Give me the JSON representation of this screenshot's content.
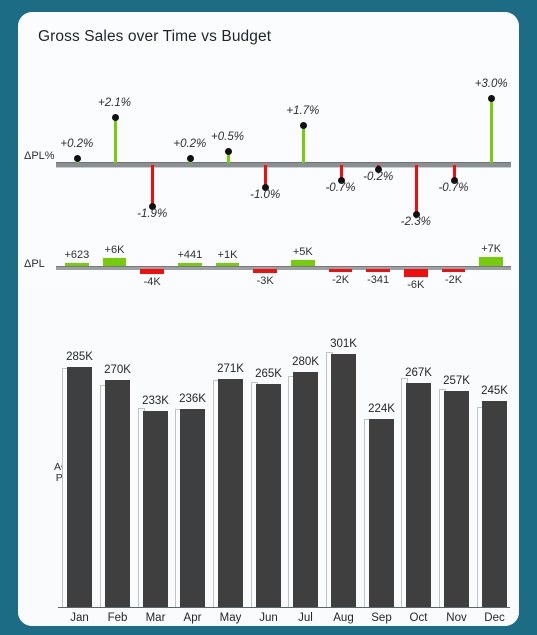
{
  "card": {
    "title": "Gross Sales over Time vs Budget",
    "background": "#1d6c85",
    "surface": "#fbfcfd"
  },
  "axes": {
    "pct_row_label": "ΔPL%",
    "abs_row_label": "ΔPL",
    "series_legend_line1": "AC",
    "series_legend_line2": "PL"
  },
  "colors": {
    "positive": "#76cc0a",
    "negative": "#f40d0d",
    "actual_bar": "#403f3f",
    "plan_bar_outline": "#bfc3c6",
    "marker": "#111111",
    "axis": "#8a8f92"
  },
  "chart_data": {
    "type": "bar",
    "title": "Gross Sales over Time vs Budget",
    "xlabel": "",
    "ylabel": "",
    "grid": false,
    "legend": [
      "AC",
      "PL"
    ],
    "legend_position": "left-inside",
    "categories": [
      "Jan",
      "Feb",
      "Mar",
      "Apr",
      "May",
      "Jun",
      "Jul",
      "Aug",
      "Sep",
      "Oct",
      "Nov",
      "Dec"
    ],
    "series": [
      {
        "name": "AC",
        "unit": "K",
        "values": [
          285,
          270,
          233,
          236,
          271,
          265,
          280,
          301,
          224,
          267,
          257,
          245
        ],
        "labels": [
          "285K",
          "270K",
          "233K",
          "236K",
          "271K",
          "265K",
          "280K",
          "301K",
          "224K",
          "267K",
          "257K",
          "245K"
        ]
      },
      {
        "name": "PL",
        "unit": "K",
        "values": [
          284,
          264,
          237,
          236,
          270,
          268,
          275,
          303,
          224,
          273,
          259,
          238
        ],
        "labels": []
      }
    ],
    "variance_absolute": {
      "name": "ΔPL",
      "labels": [
        "+623",
        "+6K",
        "-4K",
        "+441",
        "+1K",
        "-3K",
        "+5K",
        "-2K",
        "-341",
        "-6K",
        "-2K",
        "+7K"
      ],
      "values": [
        623,
        6000,
        -4000,
        441,
        1000,
        -3000,
        5000,
        -2000,
        -341,
        -6000,
        -2000,
        7000
      ]
    },
    "variance_percent": {
      "name": "ΔPL%",
      "labels": [
        "+0.2%",
        "+2.1%",
        "-1.9%",
        "+0.2%",
        "+0.5%",
        "-1.0%",
        "+1.7%",
        "-0.7%",
        "-0.2%",
        "-2.3%",
        "-0.7%",
        "+3.0%"
      ],
      "values": [
        0.2,
        2.1,
        -1.9,
        0.2,
        0.5,
        -1.0,
        1.7,
        -0.7,
        -0.2,
        -2.3,
        -0.7,
        3.0
      ],
      "ylim": [
        -2.3,
        3.0
      ]
    }
  }
}
